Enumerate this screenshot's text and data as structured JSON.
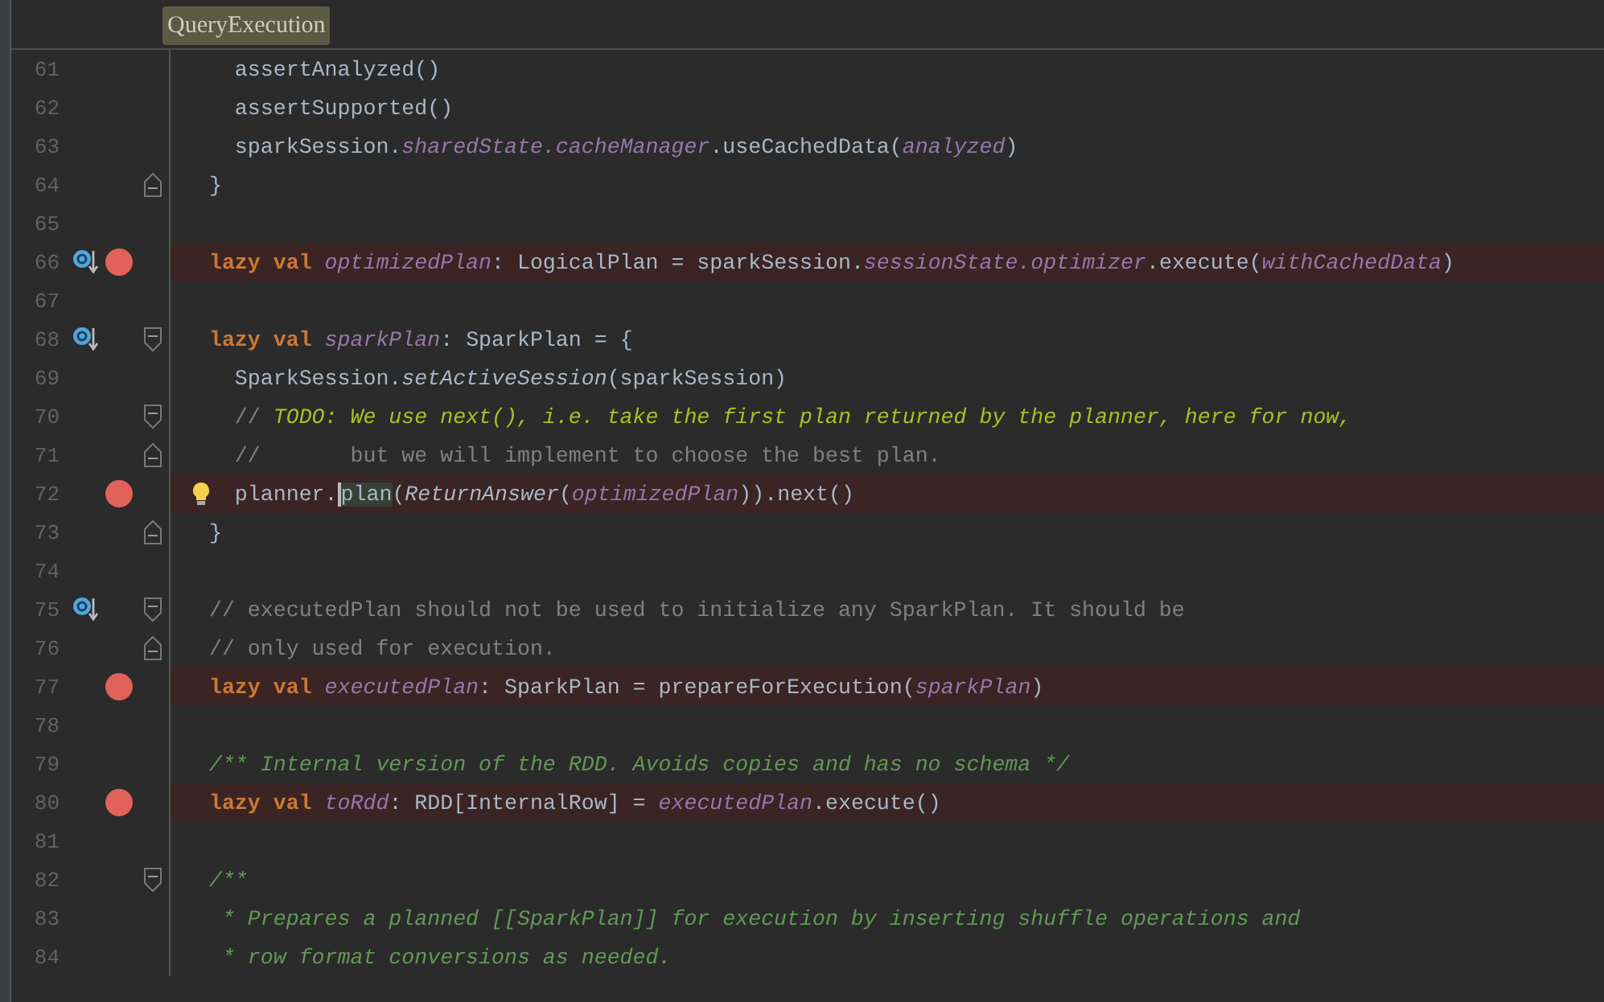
{
  "breadcrumb": "QueryExecution",
  "lines": [
    {
      "number": "61",
      "segments": [
        {
          "kind": "plain",
          "text": "    assertAnalyzed()"
        }
      ]
    },
    {
      "number": "62",
      "segments": [
        {
          "kind": "plain",
          "text": "    assertSupported()"
        }
      ]
    },
    {
      "number": "63",
      "segments": [
        {
          "kind": "plain",
          "text": "    sparkSession."
        },
        {
          "kind": "field",
          "text": "sharedState."
        },
        {
          "kind": "field",
          "text": "cacheManager"
        },
        {
          "kind": "plain",
          "text": ".useCachedData("
        },
        {
          "kind": "field",
          "text": "analyzed"
        },
        {
          "kind": "plain",
          "text": ")"
        }
      ]
    },
    {
      "number": "64",
      "fold_end": true,
      "segments": [
        {
          "kind": "plain",
          "text": "  }"
        }
      ]
    },
    {
      "number": "65"
    },
    {
      "number": "66",
      "breakpoint": true,
      "override": true,
      "segments": [
        {
          "kind": "keyword",
          "text": "  lazy val "
        },
        {
          "kind": "field",
          "text": "optimizedPlan"
        },
        {
          "kind": "plain",
          "text": ": LogicalPlan = sparkSession."
        },
        {
          "kind": "field",
          "text": "sessionState."
        },
        {
          "kind": "field",
          "text": "optimizer"
        },
        {
          "kind": "plain",
          "text": ".execute("
        },
        {
          "kind": "field",
          "text": "withCachedData"
        },
        {
          "kind": "plain",
          "text": ")"
        }
      ]
    },
    {
      "number": "67"
    },
    {
      "number": "68",
      "override": true,
      "fold_start": true,
      "segments": [
        {
          "kind": "keyword",
          "text": "  lazy val "
        },
        {
          "kind": "field",
          "text": "sparkPlan"
        },
        {
          "kind": "plain",
          "text": ": SparkPlan = {"
        }
      ]
    },
    {
      "number": "69",
      "segments": [
        {
          "kind": "plain",
          "text": "    SparkSession."
        },
        {
          "kind": "static",
          "text": "setActiveSession"
        },
        {
          "kind": "plain",
          "text": "(sparkSession)"
        }
      ]
    },
    {
      "number": "70",
      "fold_start": true,
      "segments": [
        {
          "kind": "comment",
          "text": "    // "
        },
        {
          "kind": "todo",
          "text": "TODO: We use next(), i.e. take the first plan returned by the planner, here for now,"
        }
      ]
    },
    {
      "number": "71",
      "fold_end": true,
      "segments": [
        {
          "kind": "comment",
          "text": "    //       but we will implement to choose the best plan."
        }
      ]
    },
    {
      "number": "72",
      "breakpoint": true,
      "bulb": true,
      "segments": [
        {
          "kind": "plain",
          "text": "    planner."
        },
        {
          "kind": "match",
          "text": "plan"
        },
        {
          "kind": "plain",
          "text": "("
        },
        {
          "kind": "static",
          "text": "ReturnAnswer"
        },
        {
          "kind": "plain",
          "text": "("
        },
        {
          "kind": "field",
          "text": "optimizedPlan"
        },
        {
          "kind": "plain",
          "text": ")).next()"
        }
      ]
    },
    {
      "number": "73",
      "fold_end": true,
      "segments": [
        {
          "kind": "plain",
          "text": "  }"
        }
      ]
    },
    {
      "number": "74"
    },
    {
      "number": "75",
      "override": true,
      "fold_start": true,
      "segments": [
        {
          "kind": "comment",
          "text": "  // executedPlan should not be used to initialize any SparkPlan. It should be"
        }
      ]
    },
    {
      "number": "76",
      "fold_end": true,
      "segments": [
        {
          "kind": "comment",
          "text": "  // only used for execution."
        }
      ]
    },
    {
      "number": "77",
      "breakpoint": true,
      "segments": [
        {
          "kind": "keyword",
          "text": "  lazy val "
        },
        {
          "kind": "field",
          "text": "executedPlan"
        },
        {
          "kind": "plain",
          "text": ": SparkPlan = prepareForExecution("
        },
        {
          "kind": "field",
          "text": "sparkPlan"
        },
        {
          "kind": "plain",
          "text": ")"
        }
      ]
    },
    {
      "number": "78"
    },
    {
      "number": "79",
      "segments": [
        {
          "kind": "doc",
          "text": "  /** Internal version of the RDD. Avoids copies and has no schema */"
        }
      ]
    },
    {
      "number": "80",
      "breakpoint": true,
      "segments": [
        {
          "kind": "keyword",
          "text": "  lazy val "
        },
        {
          "kind": "field",
          "text": "toRdd"
        },
        {
          "kind": "plain",
          "text": ": RDD[InternalRow] = "
        },
        {
          "kind": "field",
          "text": "executedPlan"
        },
        {
          "kind": "plain",
          "text": ".execute()"
        }
      ]
    },
    {
      "number": "81"
    },
    {
      "number": "82",
      "fold_start": true,
      "segments": [
        {
          "kind": "doc",
          "text": "  /**"
        }
      ]
    },
    {
      "number": "83",
      "segments": [
        {
          "kind": "doc",
          "text": "   * Prepares a planned [[SparkPlan]] for execution by inserting shuffle operations and"
        }
      ]
    },
    {
      "number": "84",
      "segments": [
        {
          "kind": "doc",
          "text": "   * row format conversions as needed."
        }
      ]
    }
  ]
}
